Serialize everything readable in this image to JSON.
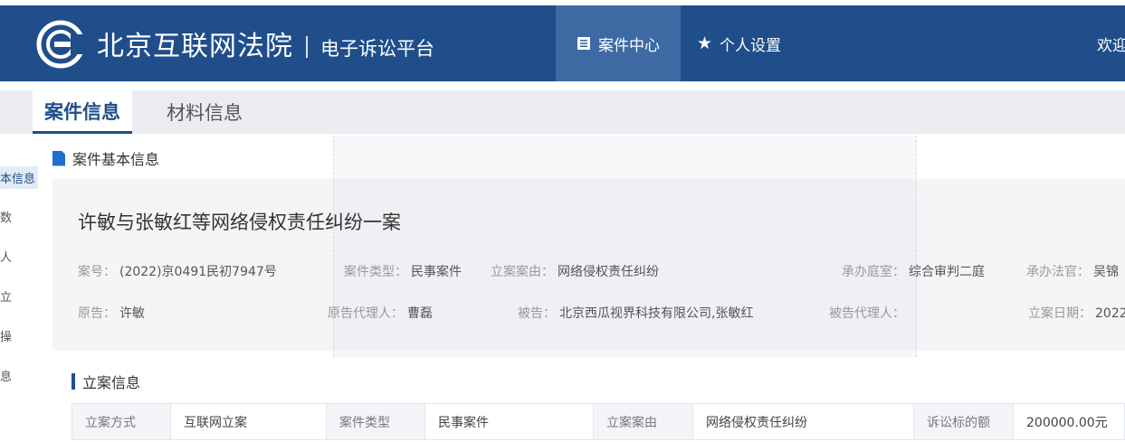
{
  "header": {
    "court_name": "北京互联网法院",
    "platform_name": "电子诉讼平台",
    "nav": [
      {
        "label": "案件中心",
        "icon": "document-list-icon",
        "active": true
      },
      {
        "label": "个人设置",
        "icon": "star-icon",
        "active": false
      }
    ],
    "user_label": "欢迎"
  },
  "tabs": [
    {
      "label": "案件信息",
      "active": true
    },
    {
      "label": "材料信息",
      "active": false
    }
  ],
  "sidebar": {
    "items": [
      "本信息",
      "数",
      "人",
      "立",
      "操",
      "息"
    ]
  },
  "basic_section": {
    "title": "案件基本信息",
    "case_title": "许敏与张敏红等网络侵权责任纠纷一案",
    "row1": [
      {
        "label": "案号：",
        "value": "(2022)京0491民初7947号"
      },
      {
        "label": "案件类型：",
        "value": "民事案件"
      },
      {
        "label": "立案案由：",
        "value": "网络侵权责任纠纷"
      },
      {
        "label": "承办庭室：",
        "value": "综合审判二庭"
      },
      {
        "label": "承办法官：",
        "value": "吴锦"
      }
    ],
    "row2": [
      {
        "label": "原告：",
        "value": "许敏"
      },
      {
        "label": "原告代理人：",
        "value": "曹磊"
      },
      {
        "label": "被告：",
        "value": "北京西瓜视界科技有限公司,张敏红"
      },
      {
        "label": "被告代理人：",
        "value": ""
      },
      {
        "label": "立案日期：",
        "value": "2022"
      }
    ]
  },
  "registration": {
    "title": "立案信息",
    "table": [
      [
        "立案方式",
        "互联网立案",
        "案件类型",
        "民事案件",
        "立案案由",
        "网络侵权责任纠纷",
        "诉讼标的额",
        "200000.00元"
      ]
    ]
  },
  "colors": {
    "header_bg": "#1f4e8b",
    "nav_active_bg": "#3d6aa3",
    "accent": "#1f6fd0"
  }
}
